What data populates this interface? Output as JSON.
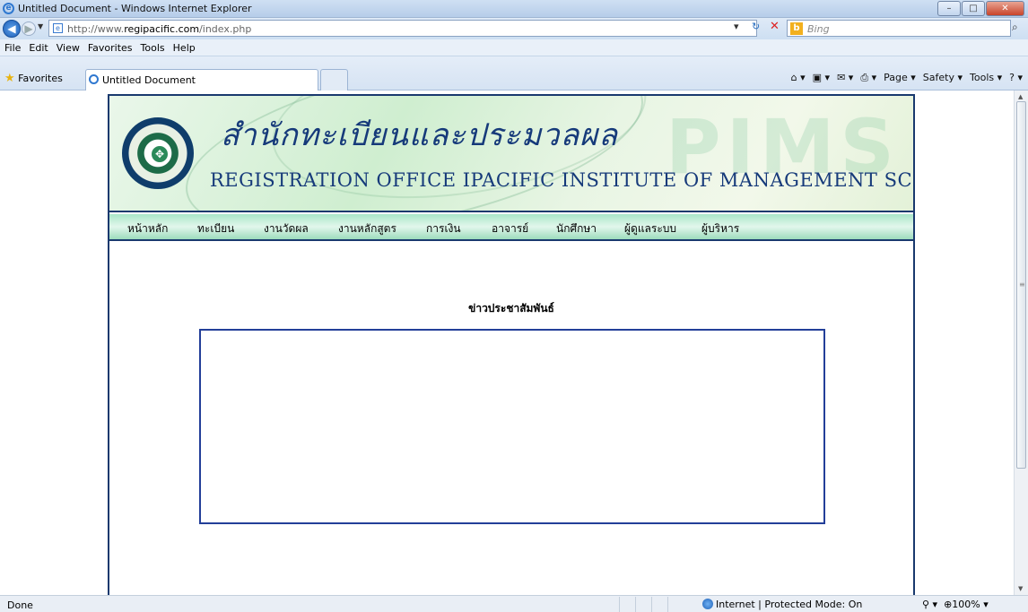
{
  "window": {
    "title": "Untitled Document - Windows Internet Explorer"
  },
  "address": {
    "url_prefix": "http://www.",
    "url_domain": "regipacific.com",
    "url_suffix": "/index.php"
  },
  "search": {
    "placeholder": "Bing"
  },
  "menubar": [
    "File",
    "Edit",
    "View",
    "Favorites",
    "Tools",
    "Help"
  ],
  "favorites": {
    "label": "Favorites"
  },
  "tab": {
    "label": "Untitled Document"
  },
  "commands": {
    "page": "Page ▾",
    "safety": "Safety ▾",
    "tools": "Tools ▾"
  },
  "site": {
    "thai_title": "สำนักทะเบียนและประมวลผล",
    "eng_title": "REGISTRATION OFFICE IPACIFIC INSTITUTE OF MANAGEMENT SCIENCE",
    "watermark": "PIMS",
    "menu": [
      "หน้าหลัก",
      "ทะเบียน",
      "งานวัดผล",
      "งานหลักสูตร",
      "การเงิน",
      "อาจารย์",
      "นักศึกษา",
      "ผู้ดูแลระบบ",
      "ผู้บริหาร"
    ],
    "news_title": "ข่าวประชาสัมพันธ์"
  },
  "status": {
    "left": "Done",
    "zone": "Internet | Protected Mode: On",
    "zoom": "100%"
  }
}
